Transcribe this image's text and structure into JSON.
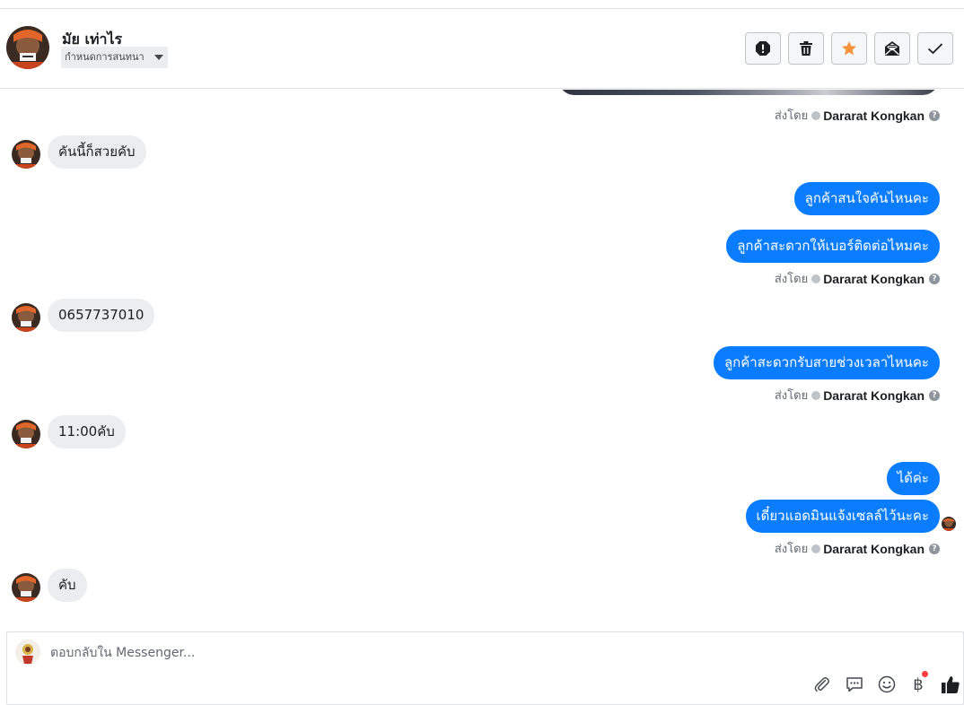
{
  "header": {
    "contact_name": "มัย เท่าไร",
    "assign_label": "กำหนดการสนทนา",
    "toolbar": [
      "spam-icon",
      "trash-icon",
      "star-icon",
      "mark-unread-icon",
      "done-icon"
    ],
    "accent_star": "#f7923b"
  },
  "thread": {
    "sent_by_label": "ส่งโดย",
    "agent_name": "Dararat Kongkan",
    "help_glyph": "?",
    "incoming": [
      {
        "text": "คันนี้ก็สวยคับ"
      },
      {
        "text": "0657737010"
      },
      {
        "text": "11:00คับ"
      },
      {
        "text": "คับ"
      }
    ],
    "outgoing": [
      {
        "text": "ลูกค้าสนใจคันไหนคะ"
      },
      {
        "text": "ลูกค้าสะดวกให้เบอร์ติดต่อไหมคะ"
      },
      {
        "text": "ลูกค้าสะดวกรับสายช่วงเวลาไหนคะ"
      },
      {
        "text": "ได้ค่ะ"
      },
      {
        "text": "เดี๋ยวแอดมินแจ้งเซลล์ไว้นะคะ"
      }
    ],
    "bubble_out_color": "#0a7cff",
    "bubble_in_color": "#ebedf0"
  },
  "composer": {
    "placeholder": "ตอบกลับใน Messenger...",
    "currency_glyph": "฿",
    "icons": [
      "paperclip-icon",
      "saved-reply-icon",
      "emoji-icon",
      "payment-icon",
      "like-icon"
    ]
  }
}
